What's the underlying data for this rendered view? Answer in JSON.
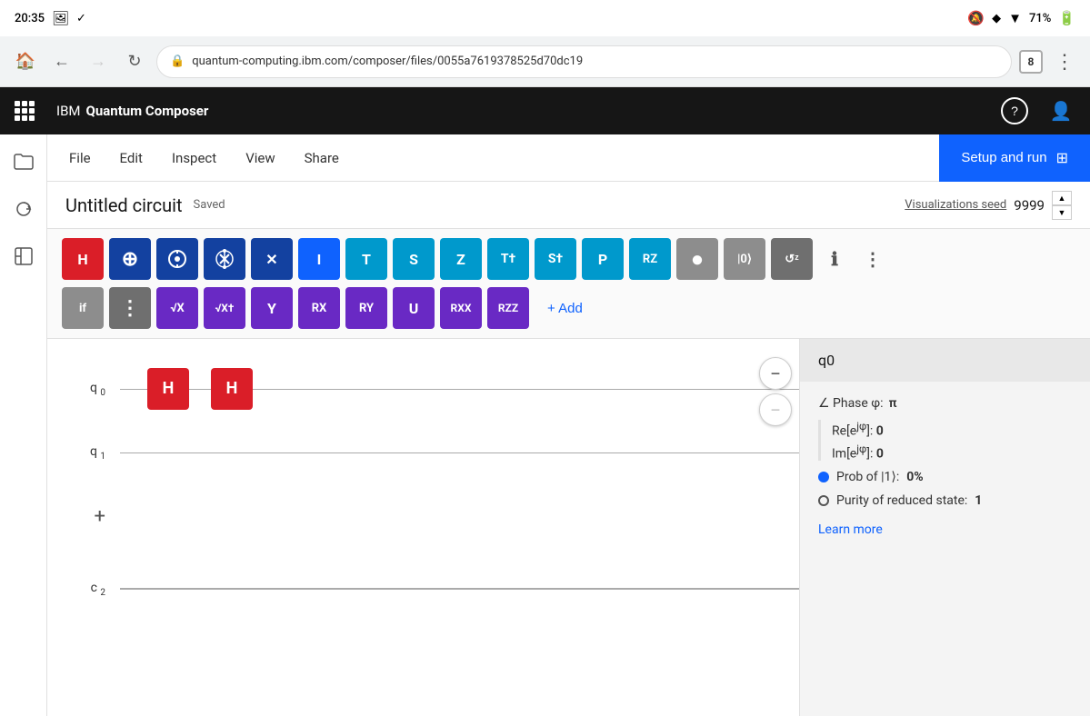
{
  "statusBar": {
    "time": "20:35",
    "battery": "71%"
  },
  "browser": {
    "url": "quantum-computing.ibm.com/composer/files/0055a7619378525d70dc19",
    "tabCount": "8"
  },
  "topNav": {
    "appName": "IBM ",
    "appNameBold": "Quantum Composer",
    "helpLabel": "?",
    "userLabel": "👤"
  },
  "menuBar": {
    "items": [
      {
        "id": "file",
        "label": "File"
      },
      {
        "id": "edit",
        "label": "Edit"
      },
      {
        "id": "inspect",
        "label": "Inspect"
      },
      {
        "id": "view",
        "label": "View"
      },
      {
        "id": "share",
        "label": "Share"
      }
    ],
    "setupRunLabel": "Setup and run"
  },
  "circuitTitle": {
    "name": "Untitled circuit",
    "savedLabel": "Saved",
    "vizSeedLabel": "Visualizations seed",
    "seedValue": "9999"
  },
  "gateToolbar": {
    "row1": [
      {
        "id": "H",
        "label": "H",
        "color": "red"
      },
      {
        "id": "X_plus",
        "label": "⊕",
        "color": "dark-blue"
      },
      {
        "id": "Y_circ",
        "label": "⊕",
        "color": "dark-blue",
        "symbol": "circ"
      },
      {
        "id": "swap",
        "label": "⊕",
        "color": "dark-blue",
        "symbol": "swap"
      },
      {
        "id": "mult",
        "label": "✕",
        "color": "dark-blue",
        "symbol": "mult"
      },
      {
        "id": "I",
        "label": "I",
        "color": "blue"
      },
      {
        "id": "T",
        "label": "T",
        "color": "cyan"
      },
      {
        "id": "S",
        "label": "S",
        "color": "cyan"
      },
      {
        "id": "Z",
        "label": "Z",
        "color": "cyan"
      },
      {
        "id": "Td",
        "label": "T†",
        "color": "cyan"
      },
      {
        "id": "Sd",
        "label": "S†",
        "color": "cyan"
      },
      {
        "id": "P",
        "label": "P",
        "color": "cyan"
      },
      {
        "id": "RZ",
        "label": "RZ",
        "color": "cyan"
      },
      {
        "id": "reset",
        "label": "●",
        "color": "gray"
      },
      {
        "id": "ket0",
        "label": "|0⟩",
        "color": "gray"
      },
      {
        "id": "Rxy",
        "label": "↺ᶻ",
        "color": "dark-gray"
      }
    ],
    "row2": [
      {
        "id": "if",
        "label": "if",
        "color": "gray"
      },
      {
        "id": "barrier",
        "label": "⋮",
        "color": "dark-gray"
      },
      {
        "id": "sqrtX",
        "label": "√X",
        "color": "maroon"
      },
      {
        "id": "sqrtXd",
        "label": "√X†",
        "color": "maroon"
      },
      {
        "id": "Y",
        "label": "Y",
        "color": "maroon"
      },
      {
        "id": "RX",
        "label": "RX",
        "color": "maroon"
      },
      {
        "id": "RY",
        "label": "RY",
        "color": "maroon"
      },
      {
        "id": "U",
        "label": "U",
        "color": "maroon"
      },
      {
        "id": "RXX",
        "label": "RXX",
        "color": "maroon"
      },
      {
        "id": "RZZ",
        "label": "RZZ",
        "color": "maroon"
      }
    ],
    "addLabel": "+ Add"
  },
  "circuit": {
    "qubits": [
      {
        "id": "q0",
        "label": "q",
        "sub": "0",
        "gates": [
          {
            "label": "H",
            "position": 1
          },
          {
            "label": "H",
            "position": 2
          }
        ]
      },
      {
        "id": "q1",
        "label": "q",
        "sub": "1",
        "gates": []
      }
    ],
    "classical": [
      {
        "id": "c2",
        "label": "c",
        "sub": "2"
      }
    ],
    "addLabel": "+"
  },
  "infoPanel": {
    "title": "q0",
    "phaseLabel": "∠ Phase φ:",
    "phaseValue": "π",
    "reLabel": "Re[e",
    "reExponent": "jφ",
    "reSuffix": "]:",
    "reValue": "0",
    "imLabel": "Im[e",
    "imExponent": "jφ",
    "imSuffix": "]:",
    "imValue": "0",
    "probLabel": "Prob of  |1⟩:",
    "probValue": "0%",
    "purityLabel": "Purity of reduced state:",
    "purityValue": "1",
    "learnMoreLabel": "Learn more"
  }
}
